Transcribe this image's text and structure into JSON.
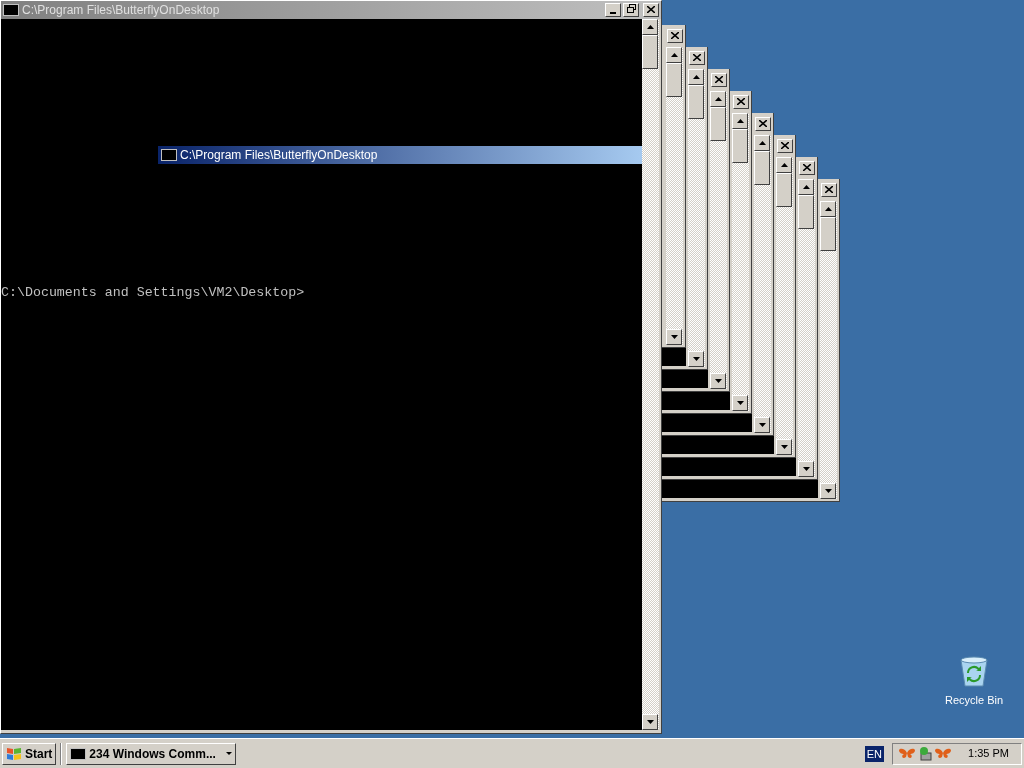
{
  "main_window": {
    "title": "C:\\Program Files\\ButterflyOnDesktop",
    "console_lines": [
      "C:\\Documents and Settings\\VM2\\Desktop>"
    ]
  },
  "floating_title_bar": {
    "title": "C:\\Program Files\\ButterflyOnDesktop"
  },
  "background_windows": [
    {
      "kind": "console"
    },
    {
      "kind": "console"
    },
    {
      "kind": "console"
    },
    {
      "kind": "console"
    },
    {
      "kind": "console"
    },
    {
      "kind": "console"
    },
    {
      "kind": "console"
    },
    {
      "kind": "console"
    }
  ],
  "desktop_icons": [
    {
      "label": "Recycle Bin"
    }
  ],
  "taskbar": {
    "start": "Start",
    "tasks": [
      {
        "label": "234 Windows Comm...",
        "selected": false
      }
    ],
    "language": "EN",
    "clock": "1:35 PM"
  }
}
